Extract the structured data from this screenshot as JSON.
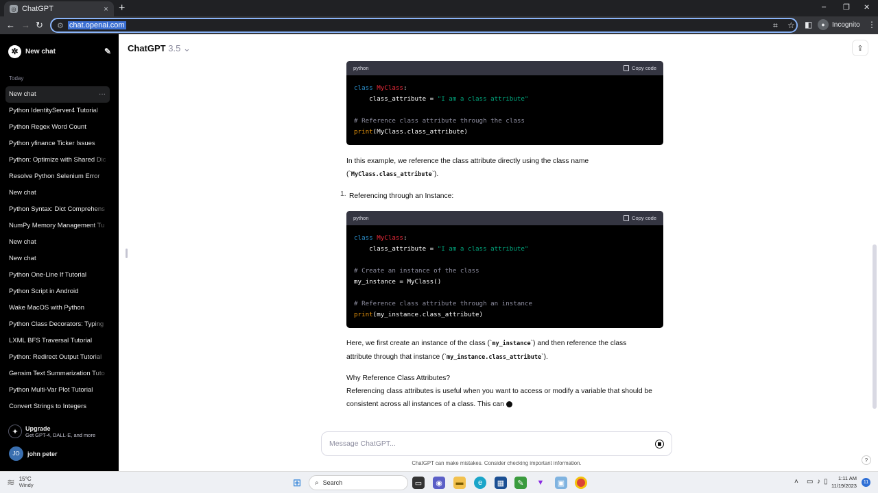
{
  "browser": {
    "tab_title": "ChatGPT",
    "tab_close": "×",
    "new_tab": "+",
    "url": "chat.openai.com",
    "incognito_label": "Incognito",
    "controls": {
      "minimize": "–",
      "restore": "❐",
      "close": "✕"
    }
  },
  "sidebar": {
    "new_chat": "New chat",
    "today_label": "Today",
    "history": [
      "New chat",
      "Python IdentityServer4 Tutorial",
      "Python Regex Word Count",
      "Python yfinance Ticker Issues",
      "Python: Optimize with Shared Dic",
      "Resolve Python Selenium Error",
      "New chat",
      "Python Syntax: Dict Comprehens",
      "NumPy Memory Management Tu",
      "New chat",
      "New chat",
      "Python One-Line If Tutorial",
      "Python Script in Android",
      "Wake MacOS with Python",
      "Python Class Decorators: Typing",
      "LXML BFS Traversal Tutorial",
      "Python: Redirect Output Tutorial",
      "Gensim Text Summarization Tuto",
      "Python Multi-Var Plot Tutorial",
      "Convert Strings to Integers"
    ],
    "more_icon": "···",
    "upgrade_title": "Upgrade",
    "upgrade_sub": "Get GPT-4, DALL·E, and more",
    "user_initials": "JO",
    "user_name": "john peter"
  },
  "header": {
    "model": "ChatGPT",
    "version": "3.5",
    "chevron": "⌄"
  },
  "content": {
    "code_lang": "python",
    "copy_label": "Copy code",
    "para1_a": "In this example, we reference the class attribute directly using the class name",
    "para1_b_open": "(`",
    "para1_b_code": "MyClass.class_attribute",
    "para1_b_close": "`).",
    "list_number": "1.",
    "list_item": "Referencing through an Instance:",
    "para2_a": "Here, we first create an instance of the class (`",
    "para2_a_code": "my_instance",
    "para2_a_mid": "`) and then reference the class",
    "para2_b": "attribute through that instance (`",
    "para2_b_code": "my_instance.class_attribute",
    "para2_b_close": "`).",
    "para3_title": "Why Reference Class Attributes?",
    "para3_a": "Referencing class attributes is useful when you want to access or modify a variable that should be",
    "para3_b": "consistent across all instances of a class. This can"
  },
  "composer": {
    "placeholder": "Message ChatGPT...",
    "disclaimer": "ChatGPT can make mistakes. Consider checking important information.",
    "help": "?"
  },
  "taskbar": {
    "temp": "15°C",
    "weather": "Windy",
    "search": "Search",
    "time": "1:11 AM",
    "date": "11/19/2023",
    "notifications": "11"
  }
}
